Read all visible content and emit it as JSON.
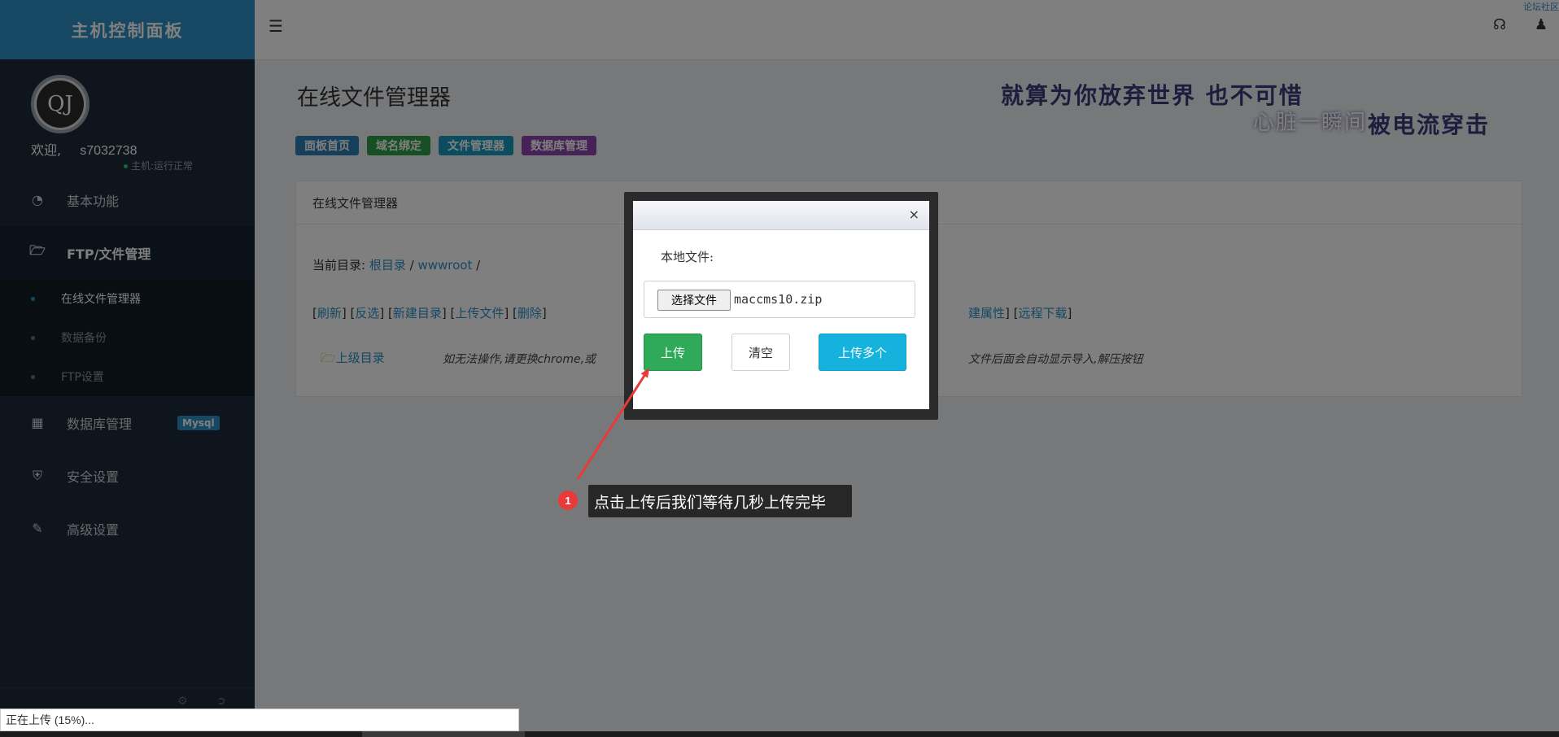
{
  "sidebar": {
    "brand": "主机控制面板",
    "avatar_text": "QJ",
    "welcome": "欢迎,",
    "username": "s7032738",
    "host_status": "主机:运行正常",
    "menu": [
      {
        "label": "基本功能",
        "icon": "dashboard-icon"
      },
      {
        "label": "FTP/文件管理",
        "icon": "folder-open-icon"
      },
      {
        "label": "数据库管理",
        "icon": "table-icon",
        "badge": "Mysql"
      },
      {
        "label": "安全设置",
        "icon": "shield-icon"
      },
      {
        "label": "高级设置",
        "icon": "edit-icon"
      }
    ],
    "submenu": [
      {
        "label": "在线文件管理器"
      },
      {
        "label": "数据备份"
      },
      {
        "label": "FTP设置"
      }
    ]
  },
  "topbar": {
    "corner_link": "论坛社区"
  },
  "page": {
    "title": "在线文件管理器",
    "slogan_line1": "就算为你放弃世界 也不可惜",
    "slogan_line2": "心脏一瞬间",
    "slogan_line3": "被电流穿击",
    "tags": [
      {
        "label": "面板首页",
        "color": "#2c7fb8"
      },
      {
        "label": "域名绑定",
        "color": "#2e9e48"
      },
      {
        "label": "文件管理器",
        "color": "#179bbd"
      },
      {
        "label": "数据库管理",
        "color": "#8e44ad"
      }
    ],
    "panel_title": "在线文件管理器",
    "current_dir_label": "当前目录:",
    "dir_root": "根目录",
    "dir_sep1": "/",
    "dir_www": "wwwroot",
    "dir_sep2": "/",
    "actions": [
      "刷新",
      "反选",
      "新建目录",
      "上传文件",
      "删除"
    ],
    "actions_tail_partial": "建属性",
    "actions_tail_remote": "远程下载",
    "up_dir": "上级目录",
    "notice_head": "如无法操作,请更换chrome,或",
    "notice_tail": "文件后面会自动显示导入,解压按钮"
  },
  "modal": {
    "close": "×",
    "local_file_label": "本地文件:",
    "choose_file": "选择文件",
    "file_name": "maccms10.zip",
    "upload": "上传",
    "clear": "清空",
    "upload_multi": "上传多个"
  },
  "callout": {
    "number": "1",
    "text": "点击上传后我们等待几秒上传完毕"
  },
  "status": {
    "text": "正在上传 (15%)...",
    "progress": 15
  }
}
